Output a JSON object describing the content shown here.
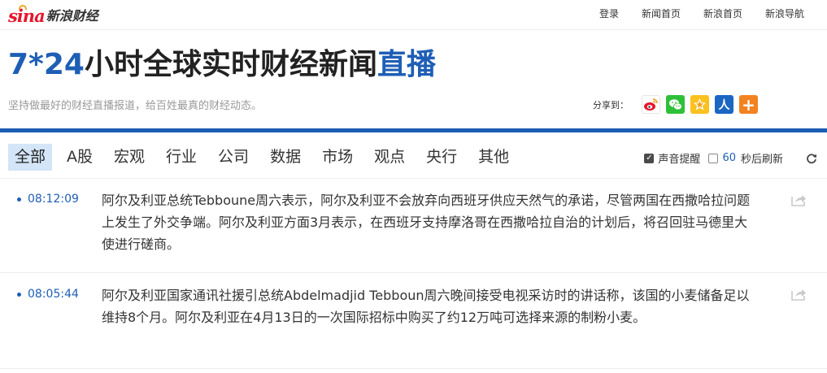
{
  "header": {
    "logo_sina": "sina",
    "logo_text": "新浪财经",
    "links": [
      "登录",
      "新闻首页",
      "新浪首页",
      "新浪导航"
    ]
  },
  "title": {
    "part1": "7*24",
    "part2": "小时全球实时财经新闻",
    "part3": "直播",
    "slogan": "坚持做最好的财经直播报道，给百姓最真的财经动态。"
  },
  "share": {
    "label": "分享到：",
    "icons": [
      "weibo-icon",
      "wechat-icon",
      "qzone-icon",
      "renren-icon",
      "more-icon"
    ],
    "renren_glyph": "人",
    "more_glyph": "+"
  },
  "tabs": [
    {
      "label": "全部",
      "active": true
    },
    {
      "label": "A股",
      "active": false
    },
    {
      "label": "宏观",
      "active": false
    },
    {
      "label": "行业",
      "active": false
    },
    {
      "label": "公司",
      "active": false
    },
    {
      "label": "数据",
      "active": false
    },
    {
      "label": "市场",
      "active": false
    },
    {
      "label": "观点",
      "active": false
    },
    {
      "label": "央行",
      "active": false
    },
    {
      "label": "其他",
      "active": false
    }
  ],
  "tools": {
    "sound_label": "声音提醒",
    "sound_checked": true,
    "refresh_seconds": "60",
    "refresh_label": "秒后刷新",
    "refresh_checked": false
  },
  "feed": [
    {
      "time": "08:12:09",
      "text": "阿尔及利亚总统Tebboune周六表示，阿尔及利亚不会放弃向西班牙供应天然气的承诺，尽管两国在西撒哈拉问题上发生了外交争端。阿尔及利亚方面3月表示，在西班牙支持摩洛哥在西撒哈拉自治的计划后，将召回驻马德里大使进行磋商。"
    },
    {
      "time": "08:05:44",
      "text": "阿尔及利亚国家通讯社援引总统Abdelmadjid Tebboun周六晚间接受电视采访时的讲话称，该国的小麦储备足以维持8个月。阿尔及利亚在4月13日的一次国际招标中购买了约12万吨可选择来源的制粉小麦。"
    }
  ],
  "colors": {
    "brand_blue": "#1e5eb5",
    "brand_red": "#e6162d",
    "active_tab_bg": "#d3e5f7"
  }
}
